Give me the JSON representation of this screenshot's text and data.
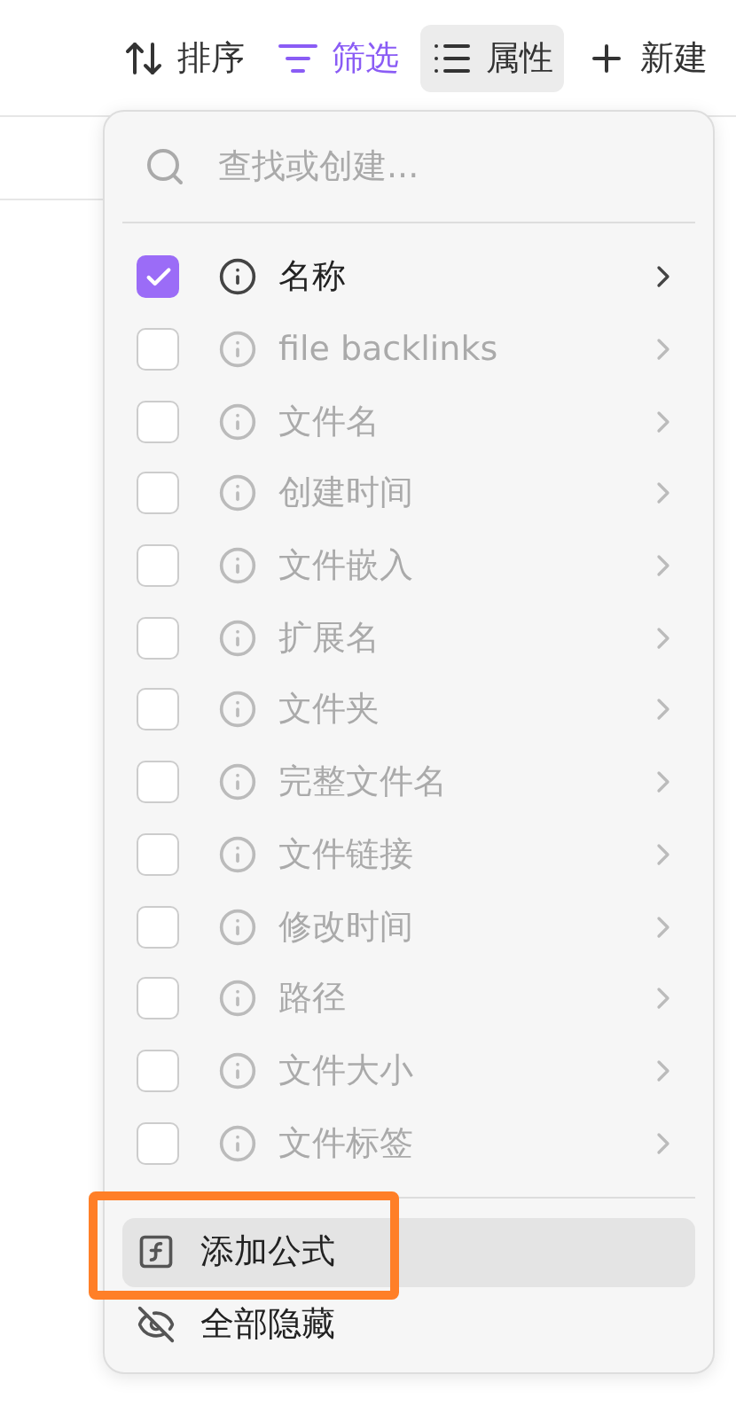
{
  "toolbar": [
    {
      "kind": "sort",
      "label": "排序",
      "active": false,
      "selected": false
    },
    {
      "kind": "filter",
      "label": "筛选",
      "active": true,
      "selected": false
    },
    {
      "kind": "properties",
      "label": "属性",
      "active": false,
      "selected": true
    },
    {
      "kind": "new",
      "label": "新建",
      "active": false,
      "selected": false
    }
  ],
  "menu": {
    "search": {
      "placeholder": "查找或创建..."
    },
    "properties": [
      {
        "label": "名称",
        "checked": true
      },
      {
        "label": "file backlinks",
        "checked": false
      },
      {
        "label": "文件名",
        "checked": false
      },
      {
        "label": "创建时间",
        "checked": false
      },
      {
        "label": "文件嵌入",
        "checked": false
      },
      {
        "label": "扩展名",
        "checked": false
      },
      {
        "label": "文件夹",
        "checked": false
      },
      {
        "label": "完整文件名",
        "checked": false
      },
      {
        "label": "文件链接",
        "checked": false
      },
      {
        "label": "修改时间",
        "checked": false
      },
      {
        "label": "路径",
        "checked": false
      },
      {
        "label": "文件大小",
        "checked": false
      },
      {
        "label": "文件标签",
        "checked": false
      }
    ],
    "actions": [
      {
        "kind": "formula",
        "label": "添加公式",
        "selected": true
      },
      {
        "kind": "hide",
        "label": "全部隐藏",
        "selected": false
      }
    ]
  }
}
